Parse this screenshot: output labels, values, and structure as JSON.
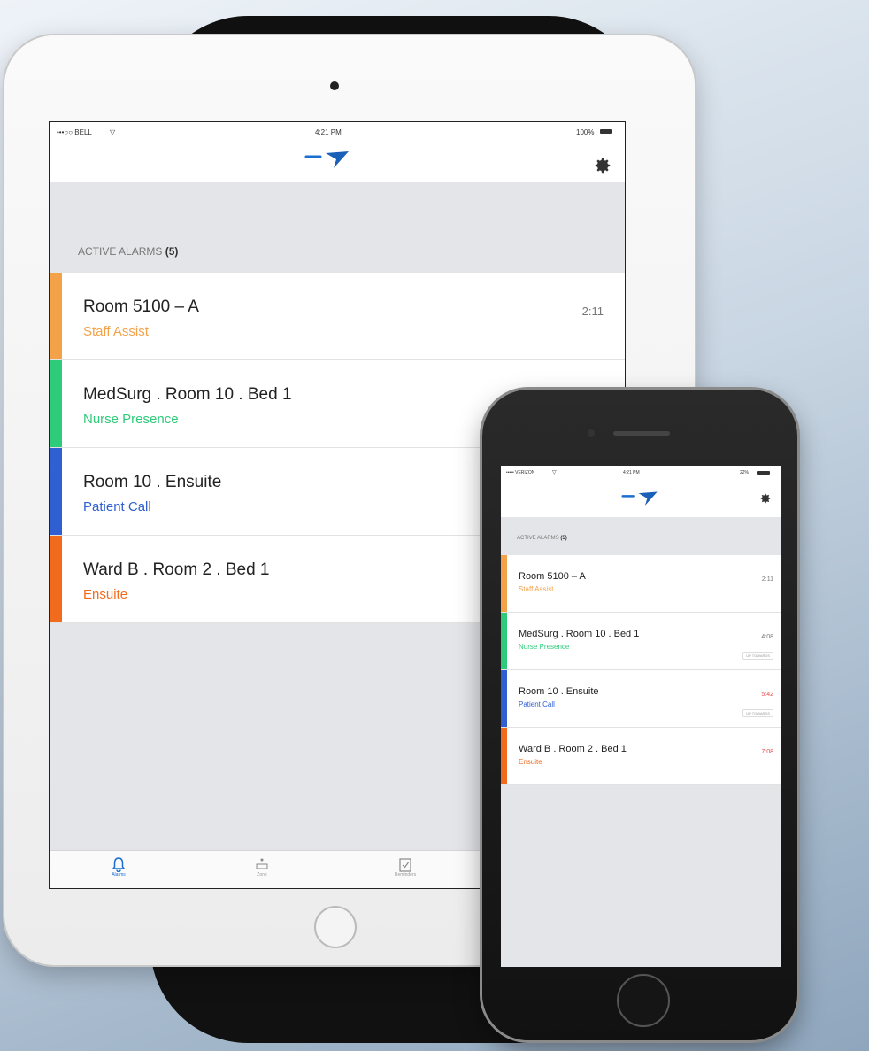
{
  "app": {
    "accent": "#1a6fd1",
    "alarm_colors": {
      "staff_assist": "#f4a24a",
      "nurse_presence": "#2ecc7a",
      "patient_call": "#2f5fd0",
      "ensuite": "#f26b1d",
      "late_time": "#e54a4a"
    }
  },
  "ipad": {
    "status": {
      "carrier": "•••○○ BELL",
      "wifi_icon": "wifi-icon",
      "time": "4:21 PM",
      "battery": "100%"
    },
    "nav": {
      "logo_icon": "logo-arrow-icon",
      "settings_icon": "gear-icon"
    },
    "section": {
      "title": "ACTIVE ALARMS",
      "count": "(5)"
    },
    "alarms": [
      {
        "title": "Room 5100 – A",
        "subtitle": "Staff Assist",
        "time": "2:11"
      },
      {
        "title": "MedSurg . Room 10 . Bed 1",
        "subtitle": "Nurse Presence",
        "time": ""
      },
      {
        "title": "Room 10 . Ensuite",
        "subtitle": "Patient Call",
        "time": ""
      },
      {
        "title": "Ward B . Room 2 . Bed 1",
        "subtitle": "Ensuite",
        "time": ""
      }
    ],
    "tabs": [
      {
        "icon": "bell-icon",
        "label": "Alarms"
      },
      {
        "icon": "zone-icon",
        "label": "Zone"
      },
      {
        "icon": "clipboard-icon",
        "label": "Reminders"
      }
    ]
  },
  "iphone": {
    "status": {
      "carrier": "••••• VERIZON",
      "wifi_icon": "wifi-icon",
      "time": "4:21 PM",
      "battery": "22%"
    },
    "nav": {
      "logo_icon": "logo-arrow-icon",
      "settings_icon": "gear-icon"
    },
    "section": {
      "title": "ACTIVE ALARMS",
      "count": "(5)"
    },
    "alarms": [
      {
        "title": "Room 5100 – A",
        "subtitle": "Staff Assist",
        "time": "2:11",
        "tag": ""
      },
      {
        "title": "MedSurg . Room 10 . Bed 1",
        "subtitle": "Nurse Presence",
        "time": "4:08",
        "tag": "UP TOWARDS"
      },
      {
        "title": "Room 10 . Ensuite",
        "subtitle": "Patient Call",
        "time": "5:42",
        "tag": "UP TOWARDS"
      },
      {
        "title": "Ward B . Room 2 . Bed 1",
        "subtitle": "Ensuite",
        "time": "7:08",
        "tag": ""
      }
    ]
  }
}
